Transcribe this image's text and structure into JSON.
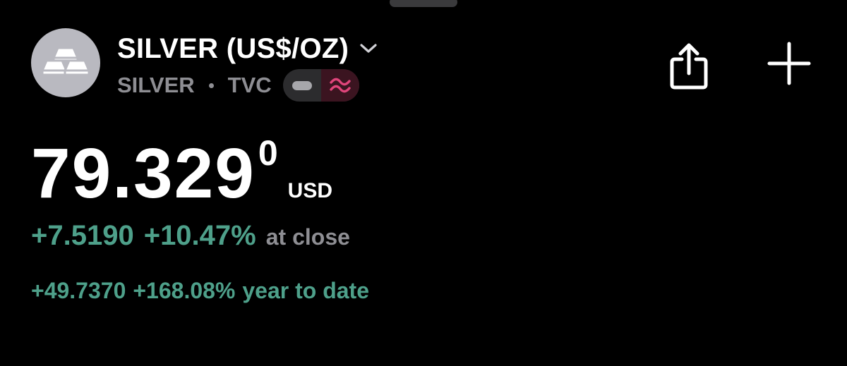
{
  "symbol": {
    "title": "SILVER (US$/OZ)",
    "ticker": "SILVER",
    "exchange": "TVC",
    "icon": "silver-bars-icon"
  },
  "header": {
    "share_icon": "share-icon",
    "add_icon": "plus-icon",
    "chevron_icon": "chevron-down-icon"
  },
  "quote": {
    "price": "79.329",
    "price_superscript": "0",
    "currency": "USD",
    "change": "+7.5190",
    "change_percent": "+10.47%",
    "change_label": "at close",
    "ytd_change": "+49.7370",
    "ytd_change_percent": "+168.08%",
    "ytd_label": "year to date"
  },
  "colors": {
    "background": "#000000",
    "positive": "#4ea08a",
    "muted": "#8e8e93",
    "avatar_bg": "#b9b9c0",
    "wave_accent": "#e0457b"
  }
}
